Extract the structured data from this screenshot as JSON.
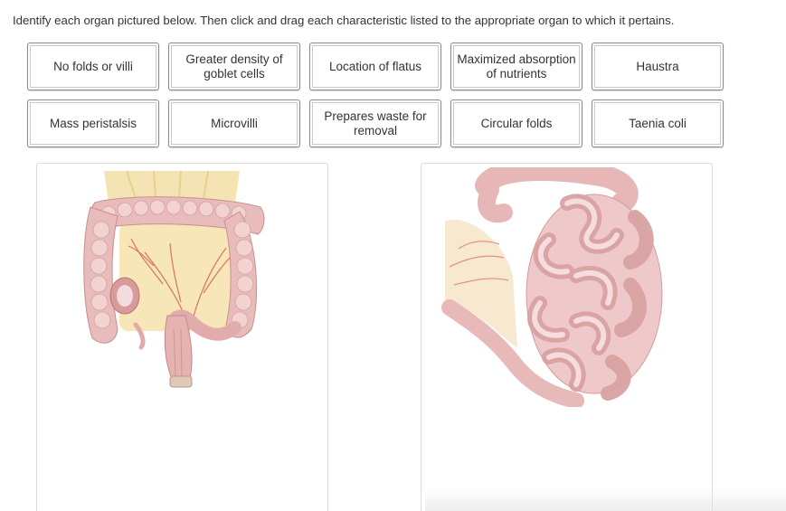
{
  "instructions": "Identify each organ pictured below.  Then click and drag each characteristic listed to the appropriate organ to which it pertains.",
  "characteristics": [
    "No folds or villi",
    "Greater density of goblet cells",
    "Location of flatus",
    "Maximized absorption of nutrients",
    "Haustra",
    "Mass peristalsis",
    "Microvilli",
    "Prepares waste for removal",
    "Circular folds",
    "Taenia coli"
  ],
  "organs": [
    {
      "image_icon": "large-intestine-illustration"
    },
    {
      "image_icon": "small-intestine-illustration"
    }
  ],
  "colors": {
    "chip_border": "#8a8a8a",
    "tissue_pink": "#e8b6b6",
    "mesentery_yellow": "#f3dfa6",
    "vessel_red": "#d9735a"
  }
}
